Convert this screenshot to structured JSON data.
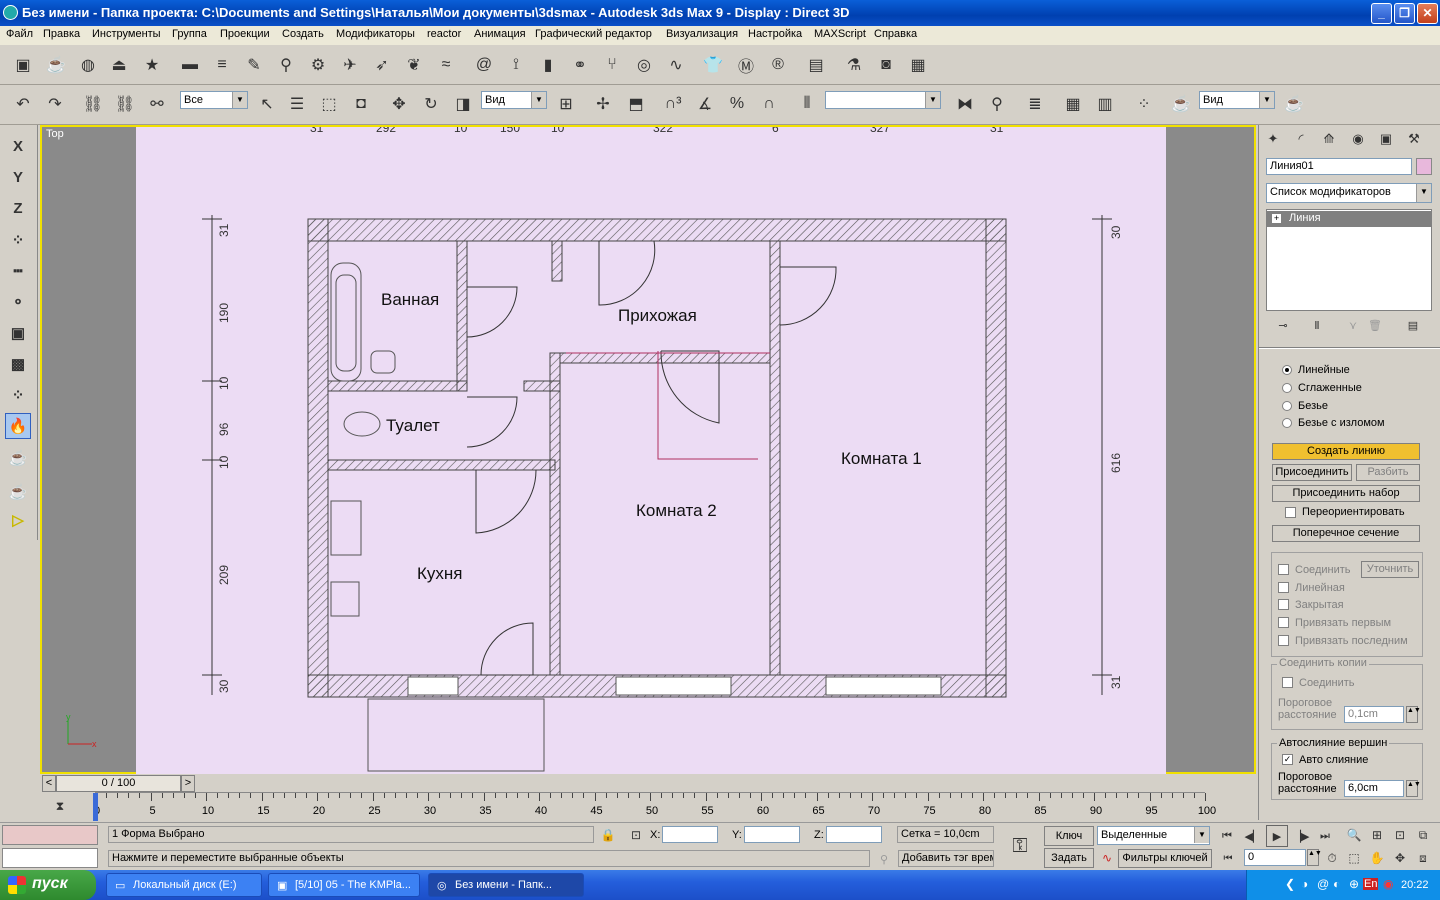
{
  "window": {
    "title": "Без имени    - Папка проекта: C:\\Documents and Settings\\Наталья\\Мои документы\\3dsmax    - Autodesk 3ds Max 9    - Display : Direct 3D"
  },
  "menu": [
    "Файл",
    "Правка",
    "Инструменты",
    "Группа",
    "Проекции",
    "Создать",
    "Модификаторы",
    "reactor",
    "Анимация",
    "Графический редактор",
    "Визуализация",
    "Настройка",
    "MAXScript",
    "Справка"
  ],
  "toolbar": {
    "selection_filter": "Все",
    "coord_system": "Вид",
    "named_selection": "",
    "view_dropdown": "Вид"
  },
  "left_toolbar": [
    "X",
    "Y",
    "Z"
  ],
  "viewport": {
    "label": "Top",
    "rooms": [
      "Ванная",
      "Прихожая",
      "Туалет",
      "Комната 1",
      "Комната 2",
      "Кухня"
    ],
    "top_dims": [
      "31",
      "292",
      "10",
      "150",
      "10",
      "322",
      "6",
      "327",
      "31"
    ],
    "left_dims": [
      "31",
      "190",
      "10",
      "96",
      "10",
      "209",
      "30"
    ],
    "right_dims": [
      "30",
      "616",
      "31"
    ],
    "axis_y": "y",
    "axis_x": "x"
  },
  "scroll": {
    "frame": "0 / 100"
  },
  "timeline": {
    "ticks": [
      "0",
      "5",
      "10",
      "15",
      "20",
      "25",
      "30",
      "35",
      "40",
      "45",
      "50",
      "55",
      "60",
      "65",
      "70",
      "75",
      "80",
      "85",
      "90",
      "95",
      "100"
    ]
  },
  "command_panel": {
    "object_name": "Линия01",
    "object_color": "#e8b8dc",
    "modifier_list": "Список модификаторов",
    "stack_item": "Линия",
    "interpolation": [
      "Линейные",
      "Сглаженные",
      "Безье",
      "Безье с изломом"
    ],
    "create_line": "Создать линию",
    "attach": "Присоединить",
    "detach": "Разбить",
    "attach_multi": "Присоединить набор",
    "reorient": "Переориентировать",
    "cross_section": "Поперечное сечение",
    "connect": "Соединить",
    "refine": "Уточнить",
    "linear": "Линейная",
    "closed": "Закрытая",
    "bind_first": "Привязать первым",
    "bind_last": "Привязать последним",
    "connect_copy_group": "Соединить копии",
    "connect_copy": "Соединить",
    "threshold_label": "Пороговое расстояние",
    "threshold_value": "0,1cm",
    "autoweld_group": "Автослияние вершин",
    "autoweld": "Авто слияние",
    "autoweld_threshold_label": "Пороговое расстояние",
    "autoweld_threshold_value": "6,0cm"
  },
  "status": {
    "selected": "1 Форма Выбрано",
    "prompt": "Нажмите и переместите выбранные объекты",
    "x_label": "X:",
    "y_label": "Y:",
    "z_label": "Z:",
    "grid": "Сетка = 10,0cm",
    "add_tag": "Добавить тэг врем",
    "key_label": "Ключ",
    "set_label": "Задать",
    "key_mode": "Выделенные",
    "key_filters": "Фильтры ключей",
    "frame": "0"
  },
  "taskbar": {
    "start": "пуск",
    "tasks": [
      "Локальный диск (E:)",
      "[5/10] 05 - The KMPla...",
      "Без имени    - Папк..."
    ],
    "lang": "EN",
    "time": "20:22",
    "tray_lang": "En"
  }
}
